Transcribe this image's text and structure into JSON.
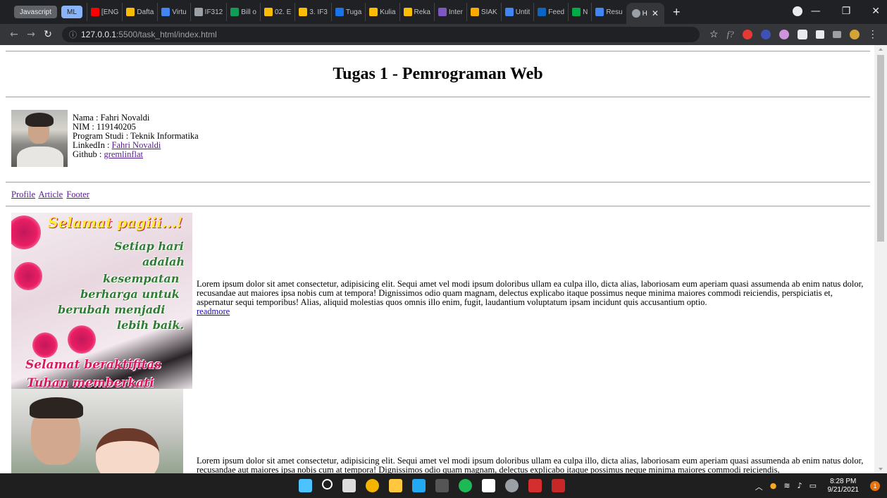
{
  "browser": {
    "tab_groups": [
      "Javascript",
      "ML"
    ],
    "tabs": [
      {
        "label": "[ENG",
        "color": "#ff0000"
      },
      {
        "label": "Dafta",
        "color": "#fbbc04"
      },
      {
        "label": "Virtu",
        "color": "#4285f4"
      },
      {
        "label": "IF312",
        "color": "#9aa0a6"
      },
      {
        "label": "Bill o",
        "color": "#0f9d58"
      },
      {
        "label": "02. E",
        "color": "#fbbc04"
      },
      {
        "label": "3. IF3",
        "color": "#fbbc04"
      },
      {
        "label": "Tuga",
        "color": "#1a73e8"
      },
      {
        "label": "Kulia",
        "color": "#fbbc04"
      },
      {
        "label": "Reka",
        "color": "#fbbc04"
      },
      {
        "label": "Inter",
        "color": "#7e57c2"
      },
      {
        "label": "SIAK",
        "color": "#f9ab00"
      },
      {
        "label": "Untit",
        "color": "#4285f4"
      },
      {
        "label": "Feed",
        "color": "#0a66c2"
      },
      {
        "label": "N",
        "color": "#00ac47"
      },
      {
        "label": "Resu",
        "color": "#4285f4"
      }
    ],
    "active_tab": {
      "label": "H",
      "close": "✕"
    },
    "new_tab": "+",
    "url_host": "127.0.0.1",
    "url_path": ":5500/task_html/index.html"
  },
  "page": {
    "title": "Tugas 1 - Pemrograman Web",
    "bio": {
      "nama": "Nama : Fahri Novaldi",
      "nim": "NIM : 119140205",
      "prodi": "Program Studi : Teknik Informatika",
      "linkedin_label": "LinkedIn : ",
      "linkedin_link": "Fahri Novaldi",
      "github_label": "Github : ",
      "github_link": "gremlinflat"
    },
    "nav": [
      "Profile",
      "Article",
      "Footer"
    ],
    "image1_text": {
      "line1": "Selamat pagiii...!",
      "line2": "Setiap hari",
      "line3": "adalah",
      "line4": "kesempatan",
      "line5": "berharga untuk",
      "line6": "berubah menjadi",
      "line7": "lebih baik.",
      "line8": "Selamat beraktifitas",
      "line9": "Tuhan memberkati"
    },
    "articles": [
      {
        "text": "Lorem ipsum dolor sit amet consectetur, adipisicing elit. Sequi amet vel modi ipsum doloribus ullam ea culpa illo, dicta alias, laboriosam eum aperiam quasi assumenda ab enim natus dolor, recusandae aut maiores ipsa nobis cum at tempora! Dignissimos odio quam magnam, delectus explicabo itaque possimus neque minima maiores commodi reiciendis, perspiciatis et, aspernatur sequi temporibus! Alias, aliquid molestias quos omnis illo enim, fugit, laudantium voluptatum ipsam incidunt quis accusantium optio.",
        "link": "readmore"
      },
      {
        "text": "Lorem ipsum dolor sit amet consectetur, adipisicing elit. Sequi amet vel modi ipsum doloribus ullam ea culpa illo, dicta alias, laboriosam eum aperiam quasi assumenda ab enim natus dolor, recusandae aut maiores ipsa nobis cum at tempora! Dignissimos odio quam magnam, delectus explicabo itaque possimus neque minima maiores commodi reiciendis,",
        "link": ""
      }
    ]
  },
  "taskbar": {
    "time": "8:28 PM",
    "date": "9/21/2021",
    "notifications": "1"
  }
}
